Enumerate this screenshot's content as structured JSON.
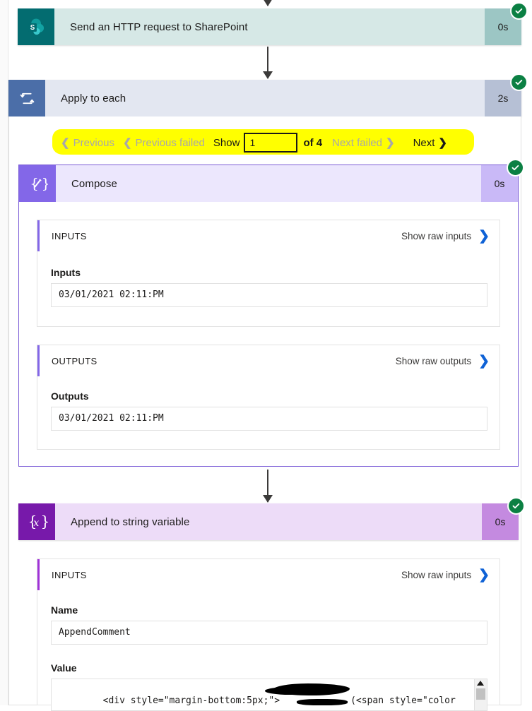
{
  "flow": {
    "steps": [
      {
        "id": "send-http-sharepoint",
        "title": "Send an HTTP request to SharePoint",
        "duration": "0s",
        "status": "succeeded",
        "icon": "sharepoint-icon",
        "icon_color": "#036c70",
        "header_color": "#d6e8e6"
      },
      {
        "id": "apply-to-each",
        "title": "Apply to each",
        "duration": "2s",
        "status": "succeeded",
        "icon": "loop-repeat-icon",
        "icon_color": "#4b6ea8",
        "header_color": "#e3e7f1"
      },
      {
        "id": "compose",
        "title": "Compose",
        "duration": "0s",
        "status": "succeeded",
        "icon": "compose-braces-pencil-icon",
        "icon_glyph": "{∕}",
        "icon_color": "#8367e8",
        "header_color": "#ece7fd"
      },
      {
        "id": "append-to-string-variable",
        "title": "Append to string variable",
        "duration": "0s",
        "status": "succeeded",
        "icon": "variable-braces-x-icon",
        "icon_glyph": "{x}",
        "icon_color": "#7719aa",
        "header_color": "#eddcf8"
      }
    ]
  },
  "pager": {
    "previous_label": "Previous",
    "previous_failed_label": "Previous failed",
    "show_label": "Show",
    "current_page": "1",
    "of_label": "of 4",
    "next_failed_label": "Next failed",
    "next_label": "Next",
    "chevron_left": "❮",
    "chevron_right": "❯",
    "highlight_color": "#ffff00",
    "disabled_color": "#a8a8a8",
    "enabled_color": "#1b1a19",
    "total_pages": 4
  },
  "compose": {
    "inputs_section": {
      "title": "INPUTS",
      "raw_link": "Show raw inputs",
      "field_label": "Inputs",
      "field_value": "03/01/2021 02:11:PM"
    },
    "outputs_section": {
      "title": "OUTPUTS",
      "raw_link": "Show raw outputs",
      "field_label": "Outputs",
      "field_value": "03/01/2021 02:11:PM"
    }
  },
  "append": {
    "inputs_section": {
      "title": "INPUTS",
      "raw_link": "Show raw inputs"
    },
    "name_label": "Name",
    "name_value": "AppendComment",
    "value_label": "Value",
    "value_text_before": "<div style=\"margin-bottom:5px;\">",
    "value_text_after": "(<span style=\"color",
    "value_redacted": true
  },
  "colors": {
    "status_green": "#0b8043",
    "link_blue": "#0f62d6",
    "connector": "#3b3a39",
    "compose_border": "#7a5cd6"
  }
}
